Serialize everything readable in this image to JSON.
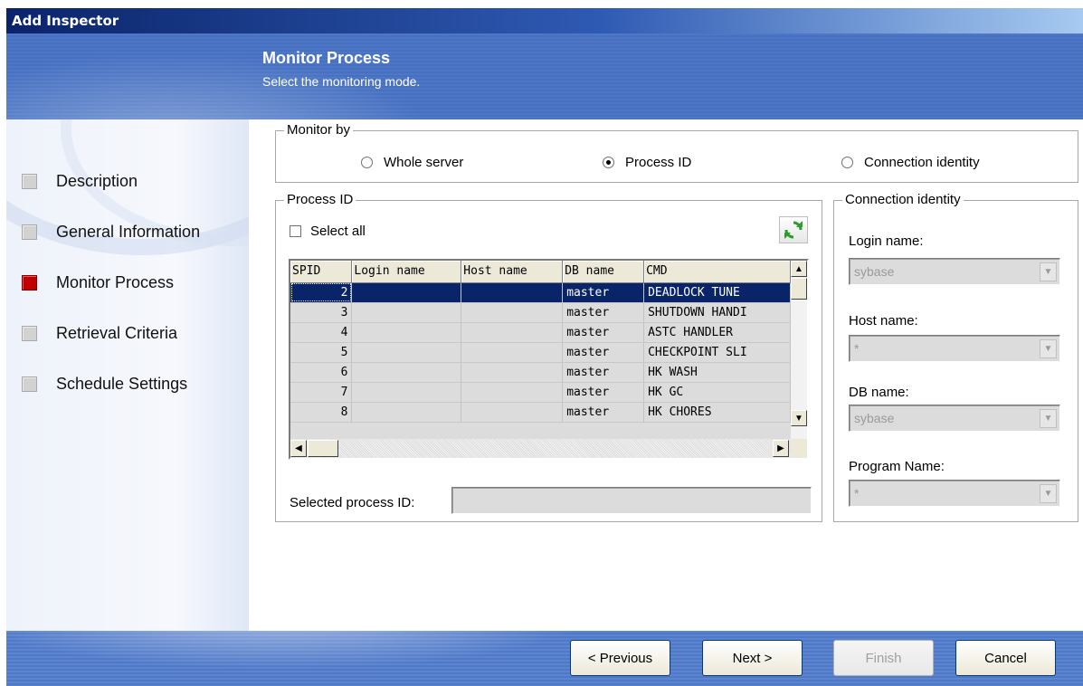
{
  "window": {
    "title": "Add Inspector"
  },
  "header": {
    "title": "Monitor Process",
    "subtitle": "Select the monitoring mode."
  },
  "sidebar": {
    "items": [
      {
        "label": "Description",
        "state": "inactive"
      },
      {
        "label": "General Information",
        "state": "inactive"
      },
      {
        "label": "Monitor Process",
        "state": "active"
      },
      {
        "label": "Retrieval Criteria",
        "state": "inactive"
      },
      {
        "label": "Schedule Settings",
        "state": "inactive"
      }
    ]
  },
  "monitor_by": {
    "legend": "Monitor by",
    "options": [
      {
        "label": "Whole server",
        "selected": false
      },
      {
        "label": "Process ID",
        "selected": true
      },
      {
        "label": "Connection identity",
        "selected": false
      }
    ]
  },
  "process_id": {
    "legend": "Process ID",
    "select_all_label": "Select all",
    "select_all_checked": false,
    "refresh_icon": "refresh-icon",
    "columns": [
      "SPID",
      "Login name",
      "Host name",
      "DB name",
      "CMD"
    ],
    "rows": [
      {
        "spid": "2",
        "login": "",
        "host": "",
        "db": "master",
        "cmd": "DEADLOCK TUNE",
        "selected": true
      },
      {
        "spid": "3",
        "login": "",
        "host": "",
        "db": "master",
        "cmd": "SHUTDOWN HANDI",
        "selected": false
      },
      {
        "spid": "4",
        "login": "",
        "host": "",
        "db": "master",
        "cmd": "ASTC HANDLER",
        "selected": false
      },
      {
        "spid": "5",
        "login": "",
        "host": "",
        "db": "master",
        "cmd": "CHECKPOINT SLI",
        "selected": false
      },
      {
        "spid": "6",
        "login": "",
        "host": "",
        "db": "master",
        "cmd": "HK WASH",
        "selected": false
      },
      {
        "spid": "7",
        "login": "",
        "host": "",
        "db": "master",
        "cmd": "HK GC",
        "selected": false
      },
      {
        "spid": "8",
        "login": "",
        "host": "",
        "db": "master",
        "cmd": "HK CHORES",
        "selected": false
      }
    ],
    "selected_label": "Selected process ID:",
    "selected_value": ""
  },
  "connection_identity": {
    "legend": "Connection identity",
    "fields": [
      {
        "label": "Login name:",
        "value": "sybase"
      },
      {
        "label": "Host name:",
        "value": "*"
      },
      {
        "label": "DB name:",
        "value": "sybase"
      },
      {
        "label": "Program Name:",
        "value": "*"
      }
    ]
  },
  "footer": {
    "previous_label": "< Previous",
    "next_label": "Next >",
    "finish_label": "Finish",
    "cancel_label": "Cancel",
    "finish_enabled": false
  },
  "colors": {
    "accent": "#0a246a",
    "header_blue": "#4671c1",
    "active_step": "#c00000",
    "selected_row": "#0a246a"
  }
}
